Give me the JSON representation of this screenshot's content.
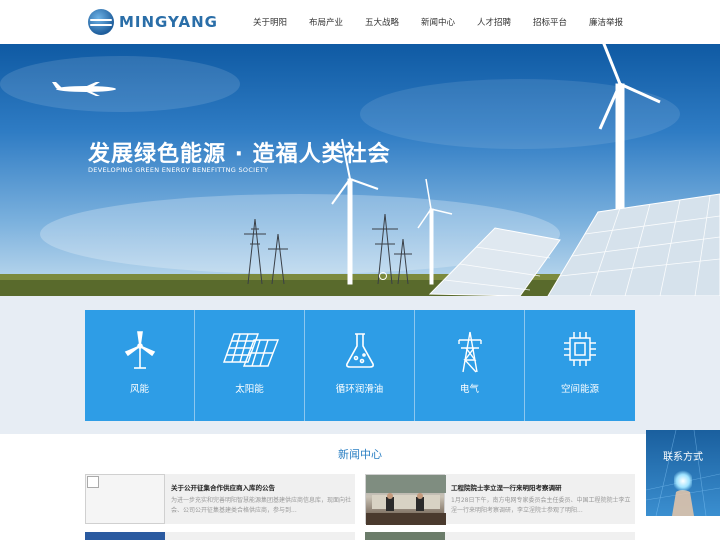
{
  "header": {
    "logo_text": "MINGYANG",
    "nav": [
      "关于明阳",
      "布局产业",
      "五大战略",
      "新闻中心",
      "人才招聘",
      "招标平台",
      "廉洁举报"
    ]
  },
  "banner": {
    "title": "发展绿色能源 · 造福人类社会",
    "subtitle": "DEVELOPING GREEN ENERGY BENEFITTNG SOCIETY"
  },
  "categories": [
    {
      "label": "风能",
      "icon": "wind-turbine-icon"
    },
    {
      "label": "太阳能",
      "icon": "solar-panel-icon"
    },
    {
      "label": "循环润滑油",
      "icon": "flask-icon"
    },
    {
      "label": "电气",
      "icon": "power-tower-icon"
    },
    {
      "label": "空间能源",
      "icon": "chip-icon"
    }
  ],
  "news": {
    "section_title": "新闻中心",
    "items": [
      {
        "title": "关于公开征集合作供应商入库的公告",
        "summary": "为进一步充实和完善明阳智慧能源集团基建供应商信息库，现面向社会、公司公开征集基建类合格供应商，参与到..."
      },
      {
        "title": "工程院院士李立浧一行来明阳考察调研",
        "summary": "1月28日下午，南方电网专家委员会主任委员、中国工程院院士李立浧一行来明阳考察调研，李立浧院士参观了明阳..."
      }
    ]
  },
  "contact": {
    "label": "联系方式"
  },
  "colors": {
    "accent": "#2e9de6",
    "link": "#2a7fc3"
  }
}
